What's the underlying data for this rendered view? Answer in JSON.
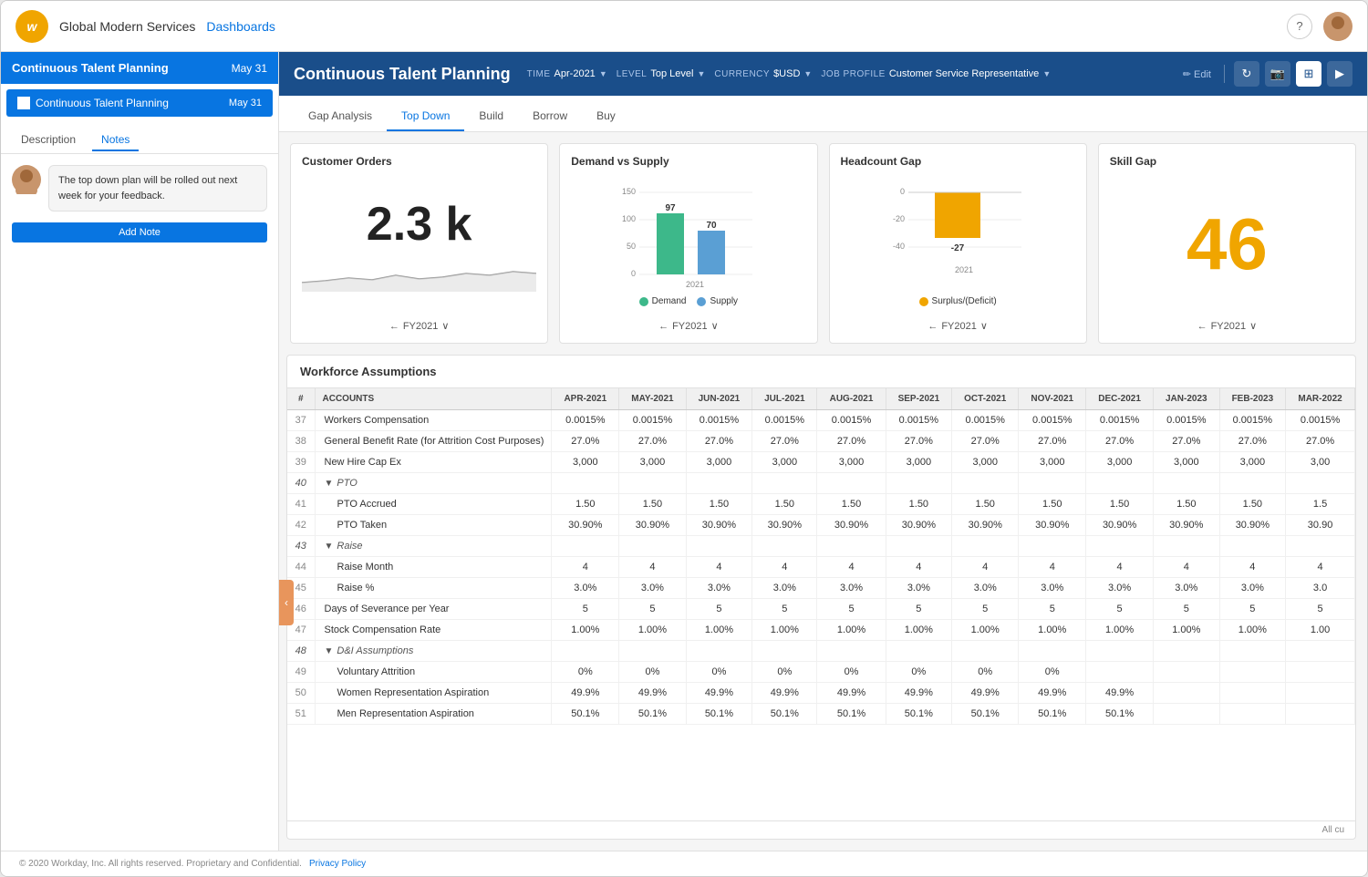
{
  "app": {
    "company": "Global Modern Services",
    "dashboards_link": "Dashboards",
    "logo_letter": "w"
  },
  "sidebar": {
    "header_title": "Continuous Talent Planning",
    "header_date": "May 31",
    "item_label": "Continuous Talent Planning",
    "item_date": "May 31",
    "tabs": [
      "Description",
      "Notes"
    ],
    "active_tab": "Notes",
    "note_text": "The top down plan will be rolled out next week for your feedback.",
    "add_note_label": "Add Note"
  },
  "content_header": {
    "title": "Continuous Talent Planning",
    "filters": [
      {
        "label": "TIME",
        "value": "Apr-2021"
      },
      {
        "label": "LEVEL",
        "value": "Top Level"
      },
      {
        "label": "CURRENCY",
        "value": "$USD"
      },
      {
        "label": "JOB PROFILE",
        "value": "Customer Service Representative"
      }
    ],
    "edit_label": "Edit"
  },
  "tabs": [
    "Gap Analysis",
    "Top Down",
    "Build",
    "Borrow",
    "Buy"
  ],
  "active_tab": "Top Down",
  "charts": {
    "customer_orders": {
      "title": "Customer Orders",
      "value": "2.3 k",
      "footer": "FY2021"
    },
    "demand_vs_supply": {
      "title": "Demand vs Supply",
      "demand_value": 97,
      "supply_value": 70,
      "year": "2021",
      "footer": "FY2021",
      "legend_demand": "Demand",
      "legend_supply": "Supply"
    },
    "headcount_gap": {
      "title": "Headcount Gap",
      "value": -27,
      "year": "2021",
      "footer": "FY2021",
      "legend_label": "Surplus/(Deficit)"
    },
    "skill_gap": {
      "title": "Skill Gap",
      "value": "46",
      "footer": "FY2021"
    }
  },
  "workforce_table": {
    "title": "Workforce Assumptions",
    "columns": [
      "#",
      "ACCOUNTS",
      "APR-2021",
      "MAY-2021",
      "JUN-2021",
      "JUL-2021",
      "AUG-2021",
      "SEP-2021",
      "OCT-2021",
      "NOV-2021",
      "DEC-2021",
      "JAN-2023",
      "FEB-2023",
      "MAR-2022"
    ],
    "rows": [
      {
        "num": "37",
        "account": "Workers Compensation",
        "values": [
          "0.0015%",
          "0.0015%",
          "0.0015%",
          "0.0015%",
          "0.0015%",
          "0.0015%",
          "0.0015%",
          "0.0015%",
          "0.0015%",
          "0.0015%",
          "0.0015%",
          "0.0015%"
        ],
        "indent": 0
      },
      {
        "num": "38",
        "account": "General Benefit Rate (for Attrition Cost Purposes)",
        "values": [
          "27.0%",
          "27.0%",
          "27.0%",
          "27.0%",
          "27.0%",
          "27.0%",
          "27.0%",
          "27.0%",
          "27.0%",
          "27.0%",
          "27.0%",
          "27.0%"
        ],
        "indent": 0
      },
      {
        "num": "39",
        "account": "New Hire Cap Ex",
        "values": [
          "3,000",
          "3,000",
          "3,000",
          "3,000",
          "3,000",
          "3,000",
          "3,000",
          "3,000",
          "3,000",
          "3,000",
          "3,000",
          "3,00"
        ],
        "indent": 0
      },
      {
        "num": "40",
        "account": "PTO",
        "values": [
          "",
          "",
          "",
          "",
          "",
          "",
          "",
          "",
          "",
          "",
          "",
          ""
        ],
        "indent": 0,
        "group": true
      },
      {
        "num": "41",
        "account": "PTO Accrued",
        "values": [
          "1.50",
          "1.50",
          "1.50",
          "1.50",
          "1.50",
          "1.50",
          "1.50",
          "1.50",
          "1.50",
          "1.50",
          "1.50",
          "1.5"
        ],
        "indent": 1
      },
      {
        "num": "42",
        "account": "PTO Taken",
        "values": [
          "30.90%",
          "30.90%",
          "30.90%",
          "30.90%",
          "30.90%",
          "30.90%",
          "30.90%",
          "30.90%",
          "30.90%",
          "30.90%",
          "30.90%",
          "30.90"
        ],
        "indent": 1
      },
      {
        "num": "43",
        "account": "Raise",
        "values": [
          "",
          "",
          "",
          "",
          "",
          "",
          "",
          "",
          "",
          "",
          "",
          ""
        ],
        "indent": 0,
        "group": true
      },
      {
        "num": "44",
        "account": "Raise Month",
        "values": [
          "4",
          "4",
          "4",
          "4",
          "4",
          "4",
          "4",
          "4",
          "4",
          "4",
          "4",
          "4"
        ],
        "indent": 1
      },
      {
        "num": "45",
        "account": "Raise %",
        "values": [
          "3.0%",
          "3.0%",
          "3.0%",
          "3.0%",
          "3.0%",
          "3.0%",
          "3.0%",
          "3.0%",
          "3.0%",
          "3.0%",
          "3.0%",
          "3.0"
        ],
        "indent": 1
      },
      {
        "num": "46",
        "account": "Days of Severance per Year",
        "values": [
          "5",
          "5",
          "5",
          "5",
          "5",
          "5",
          "5",
          "5",
          "5",
          "5",
          "5",
          "5"
        ],
        "indent": 0
      },
      {
        "num": "47",
        "account": "Stock Compensation Rate",
        "values": [
          "1.00%",
          "1.00%",
          "1.00%",
          "1.00%",
          "1.00%",
          "1.00%",
          "1.00%",
          "1.00%",
          "1.00%",
          "1.00%",
          "1.00%",
          "1.00"
        ],
        "indent": 0
      },
      {
        "num": "48",
        "account": "D&I Assumptions",
        "values": [
          "",
          "",
          "",
          "",
          "",
          "",
          "",
          "",
          "",
          "",
          "",
          ""
        ],
        "indent": 0,
        "group": true
      },
      {
        "num": "49",
        "account": "Voluntary Attrition",
        "values": [
          "0%",
          "0%",
          "0%",
          "0%",
          "0%",
          "0%",
          "0%",
          "0%",
          "",
          "",
          "",
          ""
        ],
        "indent": 1
      },
      {
        "num": "50",
        "account": "Women Representation Aspiration",
        "values": [
          "49.9%",
          "49.9%",
          "49.9%",
          "49.9%",
          "49.9%",
          "49.9%",
          "49.9%",
          "49.9%",
          "49.9%",
          "",
          "",
          ""
        ],
        "indent": 1
      },
      {
        "num": "51",
        "account": "Men Representation Aspiration",
        "values": [
          "50.1%",
          "50.1%",
          "50.1%",
          "50.1%",
          "50.1%",
          "50.1%",
          "50.1%",
          "50.1%",
          "50.1%",
          "",
          "",
          ""
        ],
        "indent": 1
      }
    ],
    "footer_note": "All cu"
  },
  "footer": {
    "copyright": "© 2020 Workday, Inc. All rights reserved. Proprietary and Confidential.",
    "privacy_policy": "Privacy Policy"
  }
}
